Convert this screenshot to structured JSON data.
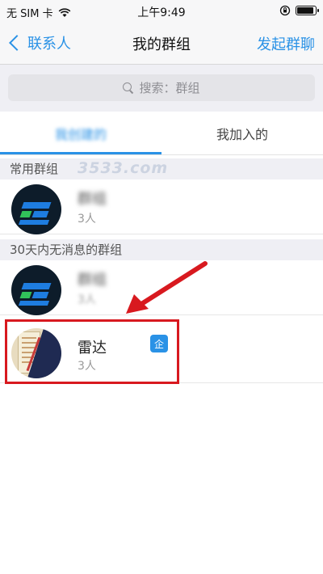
{
  "status_bar": {
    "carrier": "无 SIM 卡",
    "time": "上午9:49",
    "battery_level": 0.9,
    "icons": [
      "wifi-icon",
      "orientation-lock-icon",
      "battery-icon"
    ]
  },
  "nav": {
    "back_label": "联系人",
    "title": "我的群组",
    "action_label": "发起群聊"
  },
  "search": {
    "placeholder": "搜索：群组"
  },
  "tabs": [
    {
      "label": "我创建的",
      "active": true
    },
    {
      "label": "我加入的",
      "active": false
    }
  ],
  "watermark": "3533.com",
  "sections": [
    {
      "header": "常用群组",
      "items": [
        {
          "name": "群组",
          "members": "3人"
        }
      ]
    },
    {
      "header": "30天内无消息的群组",
      "items": [
        {
          "name": "群组",
          "members": "3人"
        },
        {
          "name": "雷达",
          "members": "3人",
          "badge": "企"
        }
      ]
    }
  ],
  "colors": {
    "accent": "#2a92e6",
    "highlight": "#d8191f",
    "background": "#efeff4"
  }
}
